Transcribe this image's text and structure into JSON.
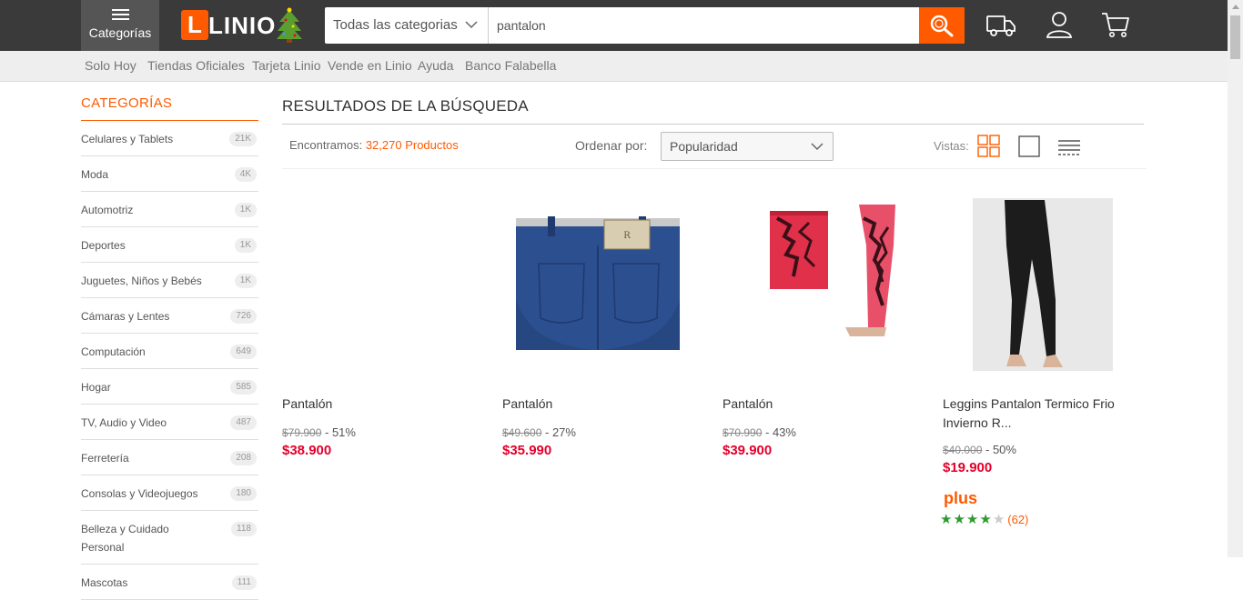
{
  "header": {
    "menu_label": "Categorías",
    "logo_text": "LINIO",
    "search": {
      "category": "Todas las categorias",
      "query": "pantalon"
    }
  },
  "subnav": [
    "Solo Hoy",
    "Tiendas Oficiales",
    "Tarjeta Linio",
    "Vende en Linio",
    "Ayuda",
    "Banco Falabella"
  ],
  "sidebar": {
    "title": "CATEGORÍAS",
    "items": [
      {
        "name": "Celulares y Tablets",
        "count": "21K"
      },
      {
        "name": "Moda",
        "count": "4K"
      },
      {
        "name": "Automotriz",
        "count": "1K"
      },
      {
        "name": "Deportes",
        "count": "1K"
      },
      {
        "name": "Juguetes, Niños y Bebés",
        "count": "1K"
      },
      {
        "name": "Cámaras y Lentes",
        "count": "726"
      },
      {
        "name": "Computación",
        "count": "649"
      },
      {
        "name": "Hogar",
        "count": "585"
      },
      {
        "name": "TV, Audio y Video",
        "count": "487"
      },
      {
        "name": "Ferretería",
        "count": "208"
      },
      {
        "name": "Consolas y Videojuegos",
        "count": "180"
      },
      {
        "name": "Belleza y Cuidado Personal",
        "count": "118"
      },
      {
        "name": "Mascotas",
        "count": "111"
      }
    ]
  },
  "results": {
    "title": "RESULTADOS DE LA BÚSQUEDA",
    "found_prefix": "Encontramos:",
    "found_count": "32,270 Productos",
    "sort_label": "Ordenar por:",
    "sort_value": "Popularidad",
    "views_label": "Vistas:"
  },
  "products": [
    {
      "title": "Pantalón",
      "old_price": "$79.900",
      "discount": " - 51%",
      "price": "$38.900"
    },
    {
      "title": "Pantalón",
      "old_price": "$49.600",
      "discount": " - 27%",
      "price": "$35.990"
    },
    {
      "title": "Pantalón",
      "old_price": "$70.990",
      "discount": " - 43%",
      "price": "$39.900"
    },
    {
      "title": "Leggins Pantalon Termico Frio Invierno R...",
      "old_price": "$40.000",
      "discount": " - 50%",
      "price": "$19.900",
      "badge": "plus",
      "rating": 4,
      "rating_count": "(62)"
    }
  ],
  "colors": {
    "brand_orange": "#ff5a00",
    "price_red": "#e4002b",
    "header_bg": "#3a3a3a",
    "star_green": "#2e9a2e"
  }
}
